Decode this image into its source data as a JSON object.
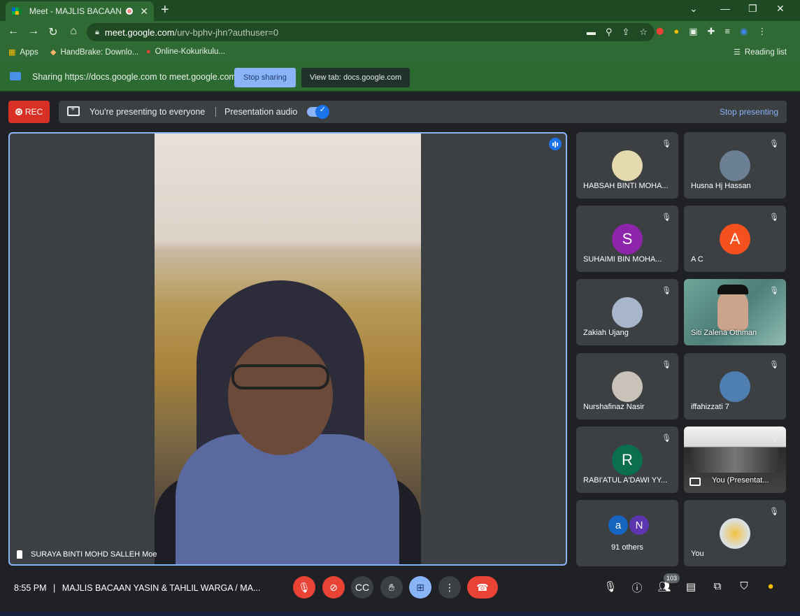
{
  "browser": {
    "tab_title": "Meet - MAJLIS BACAAN YASIN",
    "url_host": "meet.google.com",
    "url_path": "/urv-bphv-jhn?authuser=0",
    "bookmarks": [
      {
        "label": "Apps",
        "icon": "apps-grid-icon"
      },
      {
        "label": "HandBrake: Downlo...",
        "icon": "handbrake-icon"
      },
      {
        "label": "Online-Kokurikulu...",
        "icon": "kokurikulum-icon"
      }
    ],
    "reading_list": "Reading list"
  },
  "sharebar": {
    "text": "Sharing https://docs.google.com to meet.google.com",
    "stop_sharing": "Stop sharing",
    "view_tab": "View tab: docs.google.com"
  },
  "meet": {
    "rec_label": "REC",
    "presenting_text": "You're presenting to everyone",
    "presentation_audio": "Presentation audio",
    "stop_presenting": "Stop presenting",
    "main_speaker": "SURAYA BINTI MOHD SALLEH Moe",
    "participants": [
      {
        "name": "HABSAH BINTI MOHA...",
        "type": "photo",
        "color": "#e5d9b0"
      },
      {
        "name": "Husna Hj Hassan",
        "type": "photo",
        "color": "#6b7f95"
      },
      {
        "name": "SUHAIMI BIN MOHA...",
        "type": "initial",
        "initial": "S",
        "color": "#8e24aa"
      },
      {
        "name": "A C",
        "type": "initial",
        "initial": "A",
        "color": "#f4511e"
      },
      {
        "name": "Zakiah Ujang",
        "type": "photo",
        "color": "#a7b6c8"
      },
      {
        "name": "Siti Zalena Othman",
        "type": "video",
        "color": "#5e8f86"
      },
      {
        "name": "Nurshafinaz Nasir",
        "type": "photo",
        "color": "#c9c2b8"
      },
      {
        "name": "iffahizzati 7",
        "type": "photo",
        "color": "#4f7fb0"
      },
      {
        "name": "RABI'ATUL A'DAWI YY...",
        "type": "initial",
        "initial": "R",
        "color": "#0b6e4f"
      },
      {
        "name": "You (Presentat...",
        "type": "video",
        "color": "#2a2a2a"
      },
      {
        "name": "91 others",
        "type": "others",
        "minis": [
          {
            "initial": "a",
            "color": "#1565c0"
          },
          {
            "initial": "N",
            "color": "#5e35b1"
          }
        ]
      },
      {
        "name": "You",
        "type": "photo",
        "color": "#d7e3ee"
      }
    ],
    "meeting_time": "8:55 PM",
    "meeting_separator": "|",
    "meeting_title": "MAJLIS BACAAN YASIN & TAHLIL WARGA / MA...",
    "people_count": "103"
  }
}
